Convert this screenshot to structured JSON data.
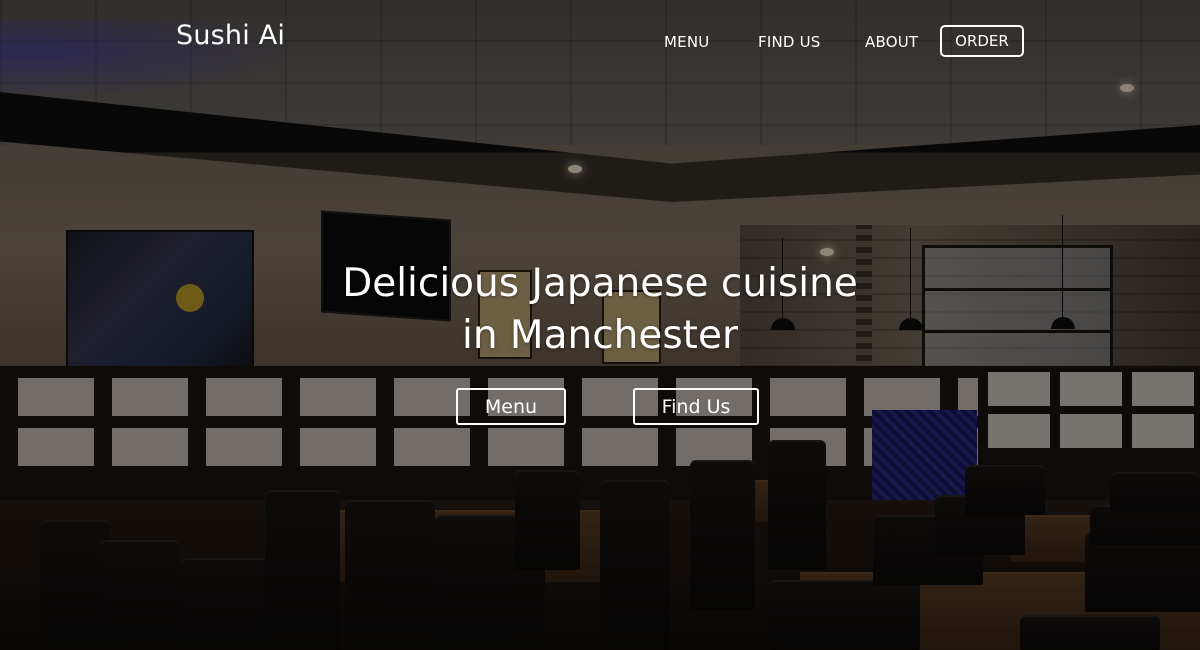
{
  "nav": {
    "brand": "Sushi Ai",
    "links": [
      {
        "label": "MENU"
      },
      {
        "label": "FIND US"
      },
      {
        "label": "ABOUT"
      }
    ],
    "order_label": "ORDER"
  },
  "hero": {
    "title_line1": "Delicious Japanese cuisine",
    "title_line2": "in Manchester",
    "buttons": [
      {
        "label": "Menu"
      },
      {
        "label": "Find Us"
      }
    ],
    "background": "restaurant-interior-photo"
  },
  "colors": {
    "text": "#ffffff",
    "overlay": "rgba(0,0,0,0.45)"
  }
}
